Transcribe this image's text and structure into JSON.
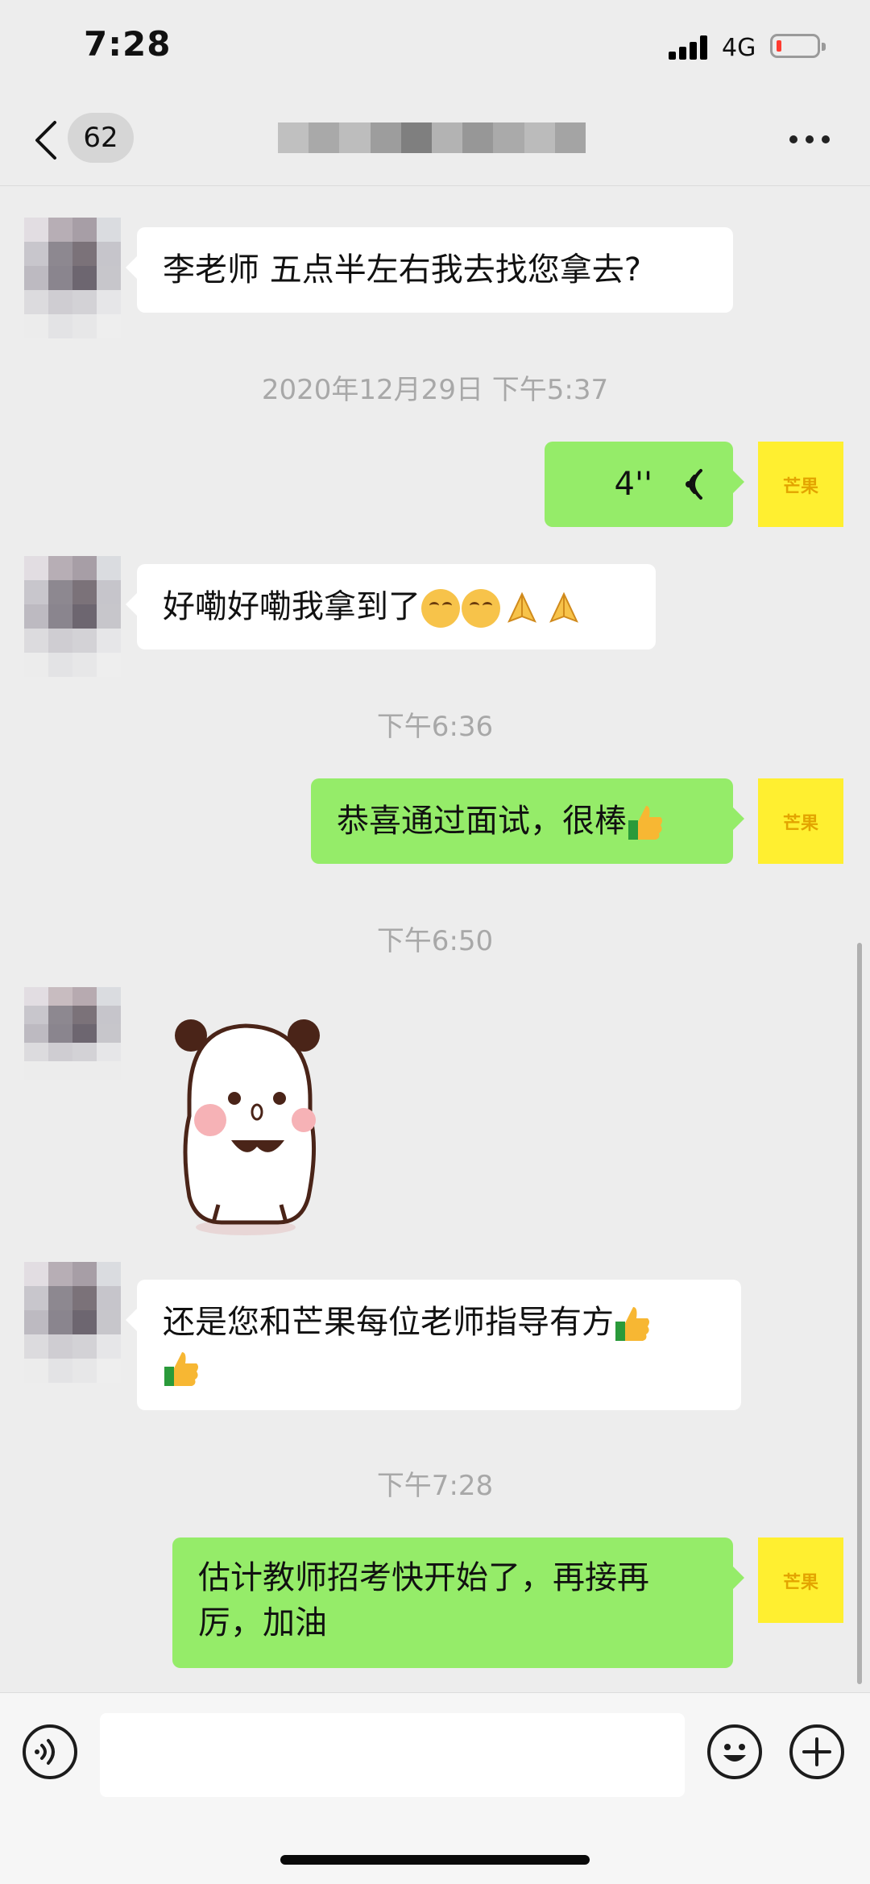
{
  "status_bar": {
    "time": "7:28",
    "network": "4G"
  },
  "header": {
    "unread_count": "62",
    "title_blurred": true
  },
  "messages": [
    {
      "side": "in",
      "type": "text",
      "text": "李老师 五点半左右我去找您拿去?"
    },
    {
      "type": "timestamp",
      "text": "2020年12月29日 下午5:37"
    },
    {
      "side": "out",
      "type": "voice",
      "duration": "4''"
    },
    {
      "side": "in",
      "type": "text",
      "text": "好嘞好嘞我拿到了",
      "emojis": [
        "blush-icon",
        "blush-icon",
        "pray-icon",
        "pray-icon"
      ]
    },
    {
      "type": "timestamp",
      "text": "下午6:36"
    },
    {
      "side": "out",
      "type": "text",
      "text": "恭喜通过面试，很棒",
      "emojis": [
        "thumbs-up-icon"
      ]
    },
    {
      "type": "timestamp",
      "text": "下午6:50"
    },
    {
      "side": "in",
      "type": "sticker",
      "sticker": "panda-sticker"
    },
    {
      "side": "in",
      "type": "text",
      "text": "还是您和芒果每位老师指导有方",
      "emojis": [
        "thumbs-up-icon",
        "thumbs-up-icon"
      ]
    },
    {
      "type": "timestamp",
      "text": "下午7:28"
    },
    {
      "side": "out",
      "type": "text",
      "text_line1": "估计教师招考快开始了，再接再",
      "text_line2": "厉，加油"
    }
  ],
  "my_avatar": {
    "logo_text": "芒果"
  },
  "colors": {
    "background": "#ededed",
    "outgoing_bubble": "#95ec69",
    "incoming_bubble": "#ffffff",
    "my_avatar_bg": "#ffef30"
  }
}
